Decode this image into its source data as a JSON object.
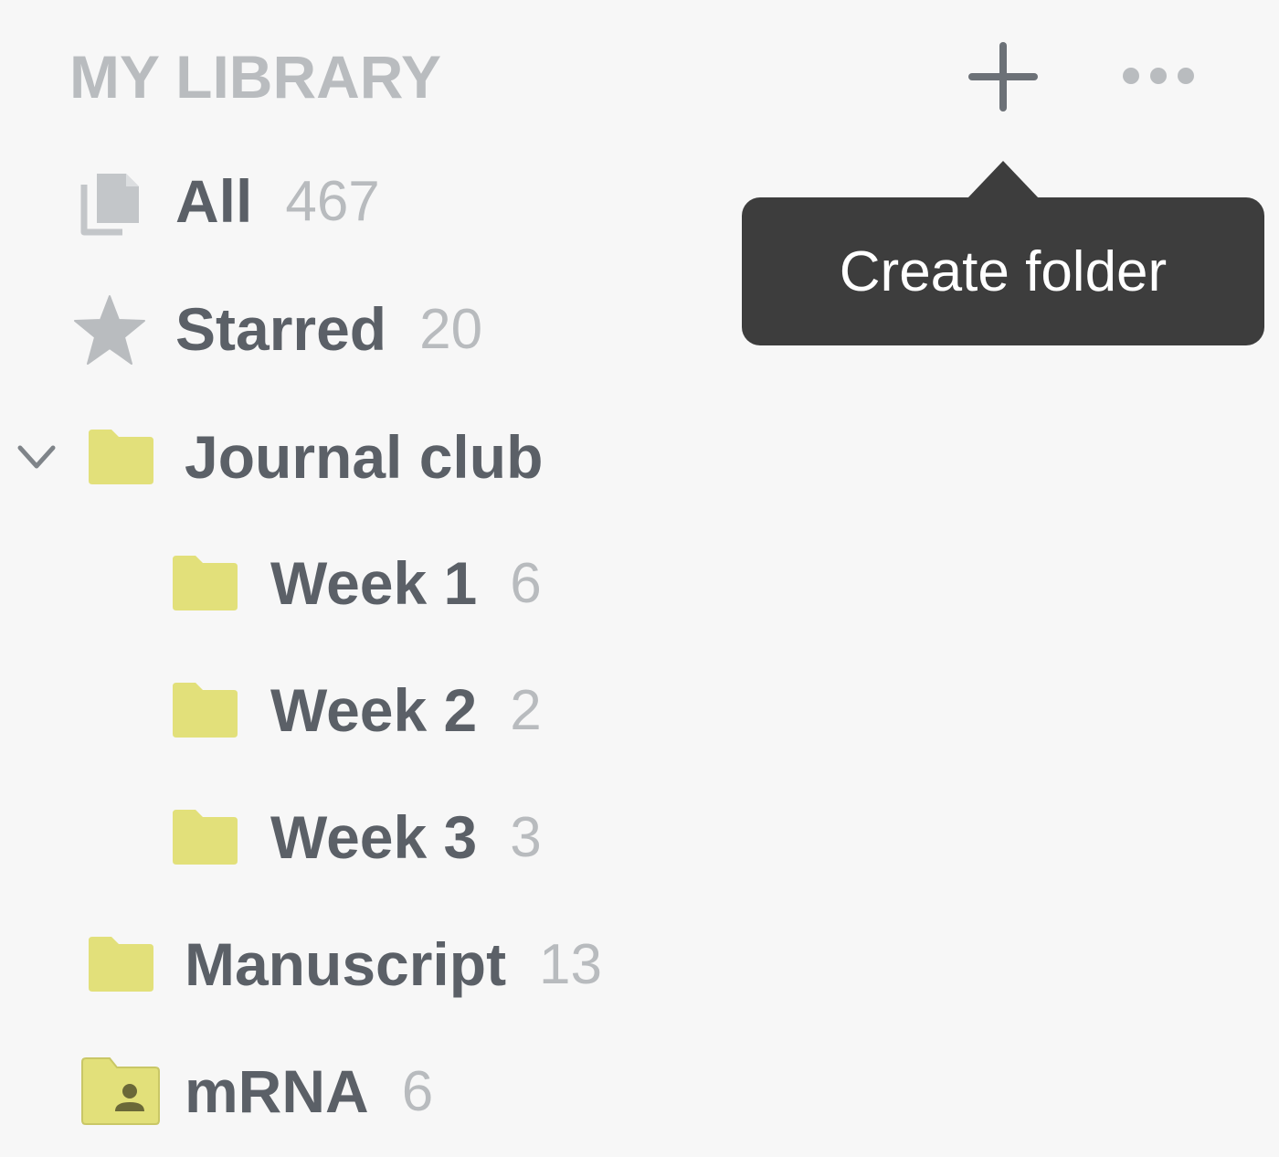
{
  "header": {
    "title": "MY LIBRARY",
    "add_icon": "plus-icon",
    "more_icon": "ellipsis-icon"
  },
  "tooltip": {
    "text": "Create folder"
  },
  "items": [
    {
      "label": "All",
      "count": "467",
      "icon": "documents-icon"
    },
    {
      "label": "Starred",
      "count": "20",
      "icon": "star-icon"
    },
    {
      "label": "Journal club",
      "count": "",
      "icon": "folder-icon",
      "expanded": true
    },
    {
      "label": "Week 1",
      "count": "6",
      "icon": "folder-icon"
    },
    {
      "label": "Week 2",
      "count": "2",
      "icon": "folder-icon"
    },
    {
      "label": "Week 3",
      "count": "3",
      "icon": "folder-icon"
    },
    {
      "label": "Manuscript",
      "count": "13",
      "icon": "folder-icon"
    },
    {
      "label": "mRNA",
      "count": "6",
      "icon": "shared-folder-icon"
    }
  ],
  "colors": {
    "background": "#f7f7f7",
    "folder": "#e2e07a",
    "label": "#5b6067",
    "count": "#b8bbbe",
    "header": "#b9bcbf",
    "tooltip_bg": "#3d3d3d"
  }
}
